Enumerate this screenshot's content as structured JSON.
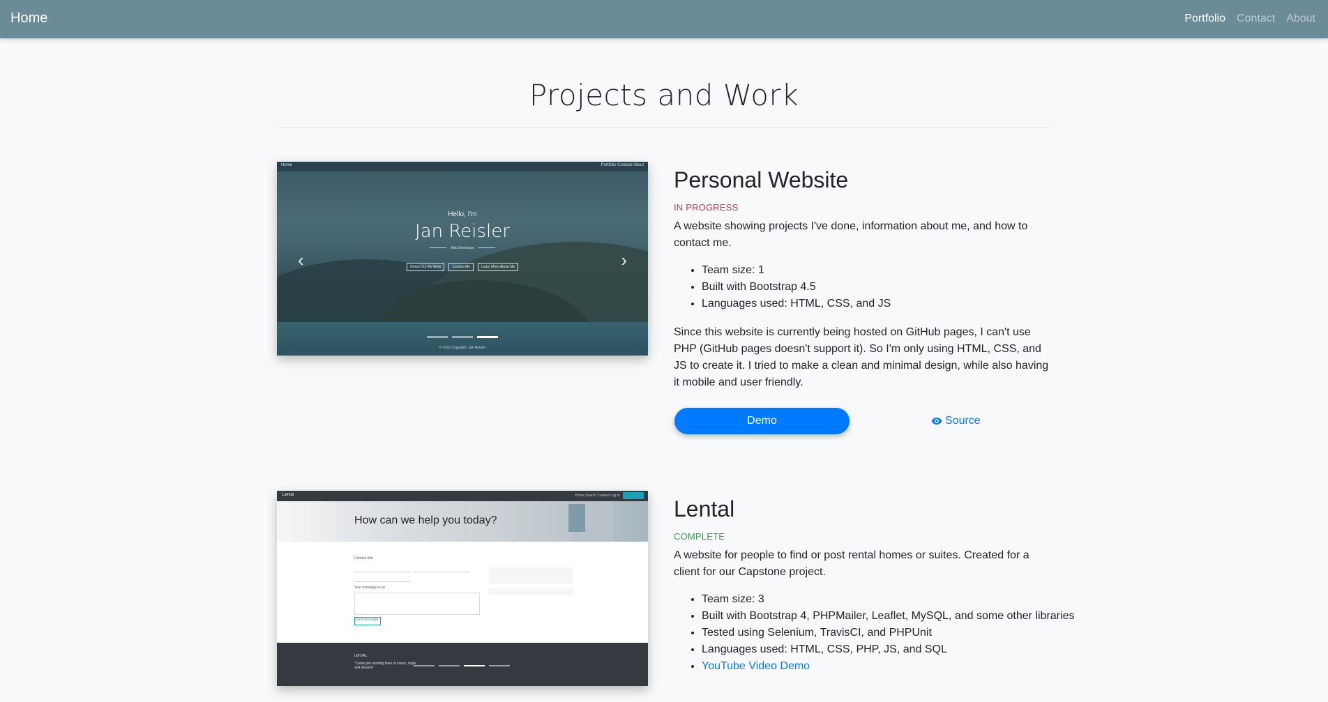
{
  "navbar": {
    "brand": "Home",
    "links": [
      {
        "label": "Portfolio",
        "active": true
      },
      {
        "label": "Contact",
        "active": false
      },
      {
        "label": "About",
        "active": false
      }
    ],
    "background": "#6b8b99"
  },
  "page": {
    "title": "Projects and Work"
  },
  "projects": [
    {
      "title": "Personal Website",
      "status": "IN PROGRESS",
      "status_color": "#dc3545",
      "description": "A website showing projects I've done, information about me, and how to contact me.",
      "bullets": [
        "Team size: 1",
        "Built with Bootstrap 4.5",
        "Languages used: HTML, CSS, and JS"
      ],
      "details": "Since this website is currently being hosted on GitHub pages, I can't use PHP (GitHub pages doesn't support it). So I'm only using HTML, CSS, and JS to create it. I tried to make a clean and minimal design, while also having it mobile and user friendly.",
      "demo_label": "Demo",
      "source_label": "Source",
      "screenshot": {
        "nav_brand": "Home",
        "nav_links": "Portfolio   Contact   About",
        "hello": "Hello, I'm",
        "name": "Jan Reisler",
        "subtitle": "Web Developer",
        "buttons": [
          "Check Out My Work",
          "Contact Me",
          "Learn More About Me"
        ],
        "footer": "© 2020 Copyright: Jan Reisler"
      }
    },
    {
      "title": "Lental",
      "status": "COMPLETE",
      "status_color": "#28a745",
      "description": "A website for people to find or post rental homes or suites. Created for a client for our Capstone project.",
      "bullets": [
        "Team size: 3",
        "Built with Bootstrap 4, PHPMailer, Leaflet, MySQL, and some other libraries",
        "Tested using Selenium, TravisCI, and PHPUnit",
        "Languages used: HTML, CSS, PHP, JS, and SQL"
      ],
      "video_link": "YouTube Video Demo",
      "screenshot": {
        "logo": "Lental",
        "nav_links": "Home  Search  Contact  Log In",
        "hero": "How can we help you today?",
        "contact_heading": "Contact Info",
        "message_heading": "Your message to us",
        "send_button": "Send message",
        "footer_brand": "LENTAL",
        "footer_tagline": "\"Come join exciting lives of lovers, hope and dreams\""
      }
    }
  ]
}
